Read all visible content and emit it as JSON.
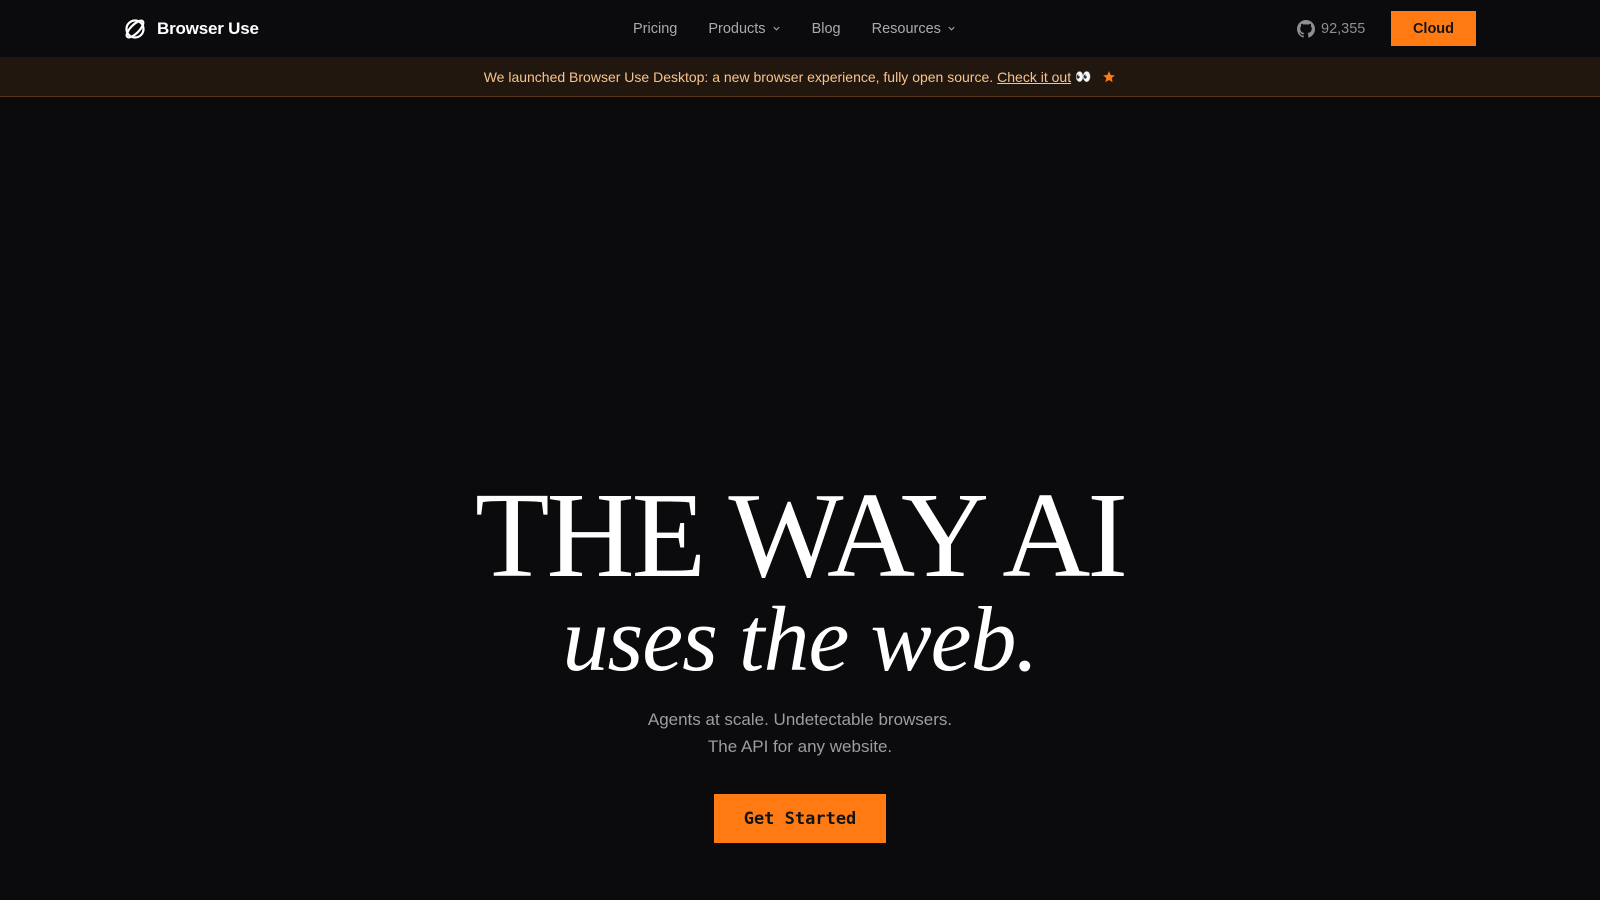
{
  "nav": {
    "brand": "Browser Use",
    "links": [
      {
        "label": "Pricing",
        "has_dropdown": false
      },
      {
        "label": "Products",
        "has_dropdown": true
      },
      {
        "label": "Blog",
        "has_dropdown": false
      },
      {
        "label": "Resources",
        "has_dropdown": true
      }
    ],
    "github_stars": "92,355",
    "github_icon": "github-icon",
    "cloud_label": "Cloud"
  },
  "banner": {
    "text": "We launched Browser Use Desktop: a new browser experience, fully open source.",
    "link_label": "Check it out",
    "emoji": "👀",
    "star_icon": "star-icon"
  },
  "hero": {
    "title_line1": "THE WAY AI",
    "title_line2": "uses the web.",
    "subtitle_line1": "Agents at scale. Undetectable browsers.",
    "subtitle_line2": "The API for any website.",
    "cta_label": "Get Started"
  },
  "colors": {
    "background": "#0b0a0c",
    "accent": "#ff7a12",
    "banner_bg": "#21170f",
    "banner_text": "#f7c48d",
    "muted_text": "#9c9ca4"
  }
}
